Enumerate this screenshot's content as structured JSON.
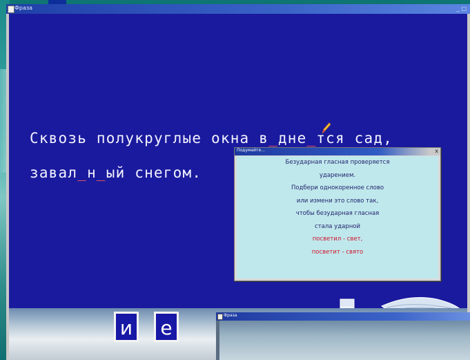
{
  "window": {
    "title": "Фраза",
    "controls": [
      "_",
      "□"
    ]
  },
  "sentence": {
    "line1_parts": [
      "Сквозь полукруглые окна в",
      "_",
      "дне",
      "_",
      "тся сад,"
    ],
    "line2_parts": [
      "завал",
      "_",
      "н",
      "_",
      "ый снегом."
    ]
  },
  "hint": {
    "title": "Подумайте...",
    "close": "x",
    "rows": [
      "Безударная гласная проверяется",
      "ударением.",
      "Подбери однокоренное слово",
      "или измени это слово так,",
      "чтобы безударная гласная",
      "стала ударной",
      "посветил - свет,",
      "посветит - свято"
    ]
  },
  "letters": [
    "и",
    "е"
  ],
  "window2": {
    "title": "Фраза"
  },
  "colors": {
    "client_bg": "#1a1a9e",
    "hint_bg": "#bfe8ec",
    "accent_red": "#d2142c"
  }
}
